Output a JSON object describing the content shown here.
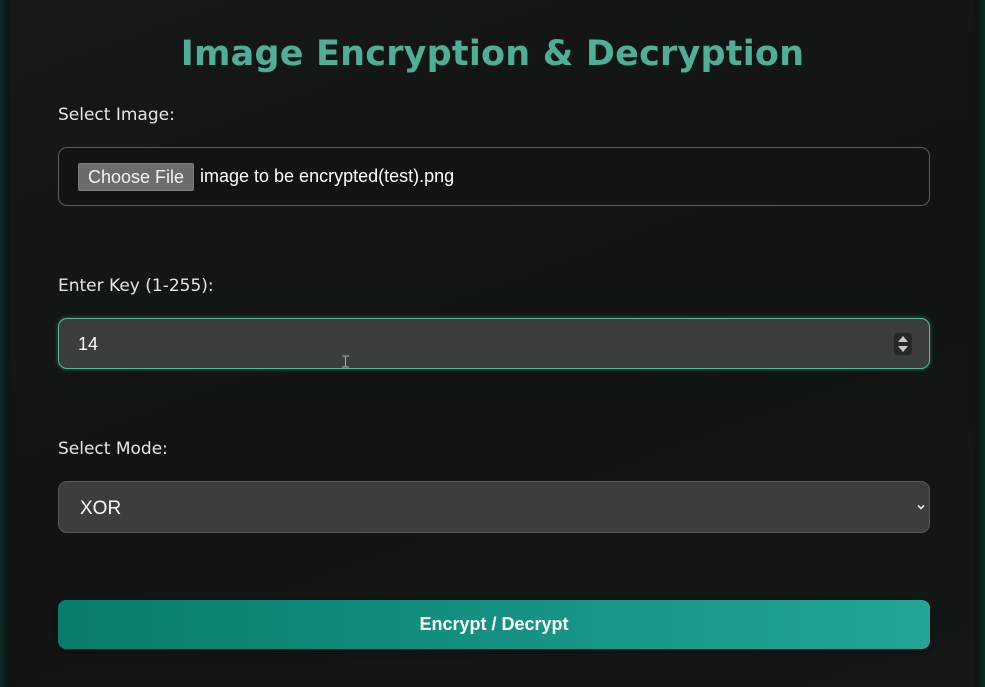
{
  "page": {
    "title": "Image Encryption & Decryption"
  },
  "image_field": {
    "label": "Select Image:",
    "button_label": "Choose File",
    "file_name": "image to be encrypted(test).png"
  },
  "key_field": {
    "label": "Enter Key (1-255):",
    "value": "14"
  },
  "mode_field": {
    "label": "Select Mode:",
    "selected": "XOR"
  },
  "action": {
    "label": "Encrypt / Decrypt"
  },
  "colors": {
    "accent": "#4fae96",
    "button_start": "#077d69",
    "button_end": "#24a595",
    "focus_border": "#58b59c",
    "background": "#111413"
  },
  "icons": {
    "spinner": "number-spinner-icon",
    "cursor": "text-cursor-icon",
    "dropdown": "chevron-down-icon"
  }
}
